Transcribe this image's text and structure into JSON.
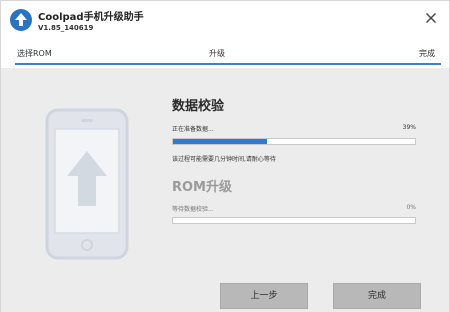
{
  "window": {
    "title": "Coolpad手机升级助手",
    "version": "V1.85_140619"
  },
  "steps": [
    {
      "label": "选择ROM"
    },
    {
      "label": "升级"
    },
    {
      "label": "完成"
    }
  ],
  "verify": {
    "title": "数据校验",
    "status": "正在准备数据...",
    "percent_label": "39%",
    "progress": 0.39,
    "hint": "该过程可能需要几分钟时间,请耐心等待"
  },
  "rom": {
    "title": "ROM升级",
    "status": "等待数据校验...",
    "percent_label": "0%",
    "progress": 0
  },
  "buttons": {
    "prev_label": "上一步",
    "done_label": "完成"
  },
  "colors": {
    "accent": "#2f7bd1",
    "panel_bg": "#ececec",
    "button_bg": "#b8b8b8",
    "phone_outline": "#d3d9e1"
  },
  "icons": {
    "app": "upload-arrow-icon",
    "close": "close-icon",
    "phone": "phone-upgrade-icon"
  }
}
